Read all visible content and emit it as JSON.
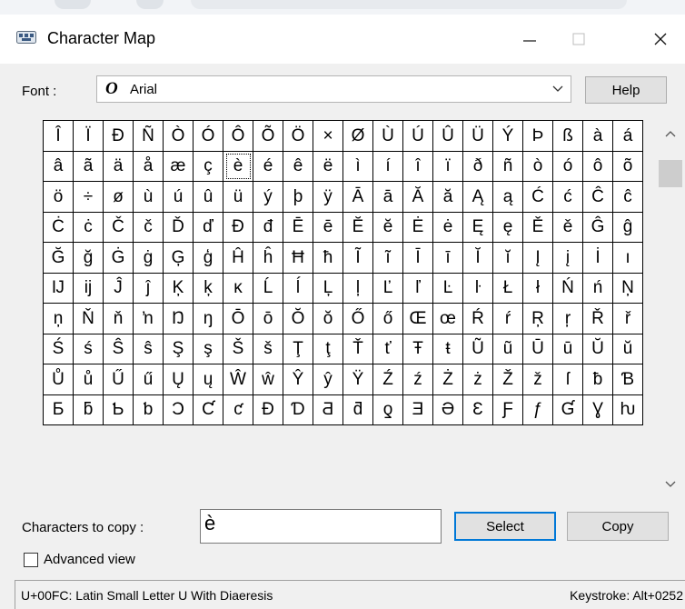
{
  "window": {
    "title": "Character Map"
  },
  "font": {
    "label": "Font :",
    "value": "Arial",
    "icon_glyph": "O",
    "help_label": "Help"
  },
  "grid": {
    "rows": [
      [
        "Î",
        "Ï",
        "Ð",
        "Ñ",
        "Ò",
        "Ó",
        "Ô",
        "Õ",
        "Ö",
        "×",
        "Ø",
        "Ù",
        "Ú",
        "Û",
        "Ü",
        "Ý",
        "Þ",
        "ß",
        "à",
        "á"
      ],
      [
        "â",
        "ã",
        "ä",
        "å",
        "æ",
        "ç",
        "è",
        "é",
        "ê",
        "ë",
        "ì",
        "í",
        "î",
        "ï",
        "ð",
        "ñ",
        "ò",
        "ó",
        "ô",
        "õ"
      ],
      [
        "ö",
        "÷",
        "ø",
        "ù",
        "ú",
        "û",
        "ü",
        "ý",
        "þ",
        "ÿ",
        "Ā",
        "ā",
        "Ă",
        "ă",
        "Ą",
        "ą",
        "Ć",
        "ć",
        "Ĉ",
        "ĉ"
      ],
      [
        "Ċ",
        "ċ",
        "Č",
        "č",
        "Ď",
        "ď",
        "Đ",
        "đ",
        "Ē",
        "ē",
        "Ĕ",
        "ĕ",
        "Ė",
        "ė",
        "Ę",
        "ę",
        "Ě",
        "ě",
        "Ĝ",
        "ĝ"
      ],
      [
        "Ğ",
        "ğ",
        "Ġ",
        "ġ",
        "Ģ",
        "ģ",
        "Ĥ",
        "ĥ",
        "Ħ",
        "ħ",
        "Ĩ",
        "ĩ",
        "Ī",
        "ī",
        "Ĭ",
        "ĭ",
        "Į",
        "į",
        "İ",
        "ı"
      ],
      [
        "Ĳ",
        "ĳ",
        "Ĵ",
        "ĵ",
        "Ķ",
        "ķ",
        "ĸ",
        "Ĺ",
        "ĺ",
        "Ļ",
        "ļ",
        "Ľ",
        "ľ",
        "Ŀ",
        "ŀ",
        "Ł",
        "ł",
        "Ń",
        "ń",
        "Ņ"
      ],
      [
        "ņ",
        "Ň",
        "ň",
        "ŉ",
        "Ŋ",
        "ŋ",
        "Ō",
        "ō",
        "Ŏ",
        "ŏ",
        "Ő",
        "ő",
        "Œ",
        "œ",
        "Ŕ",
        "ŕ",
        "Ŗ",
        "ŗ",
        "Ř",
        "ř"
      ],
      [
        "Ś",
        "ś",
        "Ŝ",
        "ŝ",
        "Ş",
        "ş",
        "Š",
        "š",
        "Ţ",
        "ţ",
        "Ť",
        "ť",
        "Ŧ",
        "ŧ",
        "Ũ",
        "ũ",
        "Ū",
        "ū",
        "Ŭ",
        "ŭ"
      ],
      [
        "Ů",
        "ů",
        "Ű",
        "ű",
        "Ų",
        "ų",
        "Ŵ",
        "ŵ",
        "Ŷ",
        "ŷ",
        "Ÿ",
        "Ź",
        "ź",
        "Ż",
        "ż",
        "Ž",
        "ž",
        "ſ",
        "ƀ",
        "Ɓ"
      ],
      [
        "Ƃ",
        "ƃ",
        "Ƅ",
        "ƅ",
        "Ɔ",
        "Ƈ",
        "ƈ",
        "Ɖ",
        "Ɗ",
        "Ƌ",
        "ƌ",
        "ƍ",
        "Ǝ",
        "Ə",
        "Ɛ",
        "Ƒ",
        "ƒ",
        "Ɠ",
        "Ɣ",
        "ƕ"
      ]
    ],
    "selected": {
      "row": 1,
      "col": 6
    }
  },
  "copy": {
    "label": "Characters to copy :",
    "value": "è",
    "select_label": "Select",
    "copy_label": "Copy"
  },
  "advanced": {
    "label": "Advanced view",
    "checked": false
  },
  "status": {
    "description": "U+00FC: Latin Small Letter U With Diaeresis",
    "keystroke": "Keystroke: Alt+0252"
  },
  "icons": {
    "app": "character-map-icon",
    "minimize": "minimize-icon",
    "maximize": "maximize-icon",
    "close": "close-icon"
  }
}
